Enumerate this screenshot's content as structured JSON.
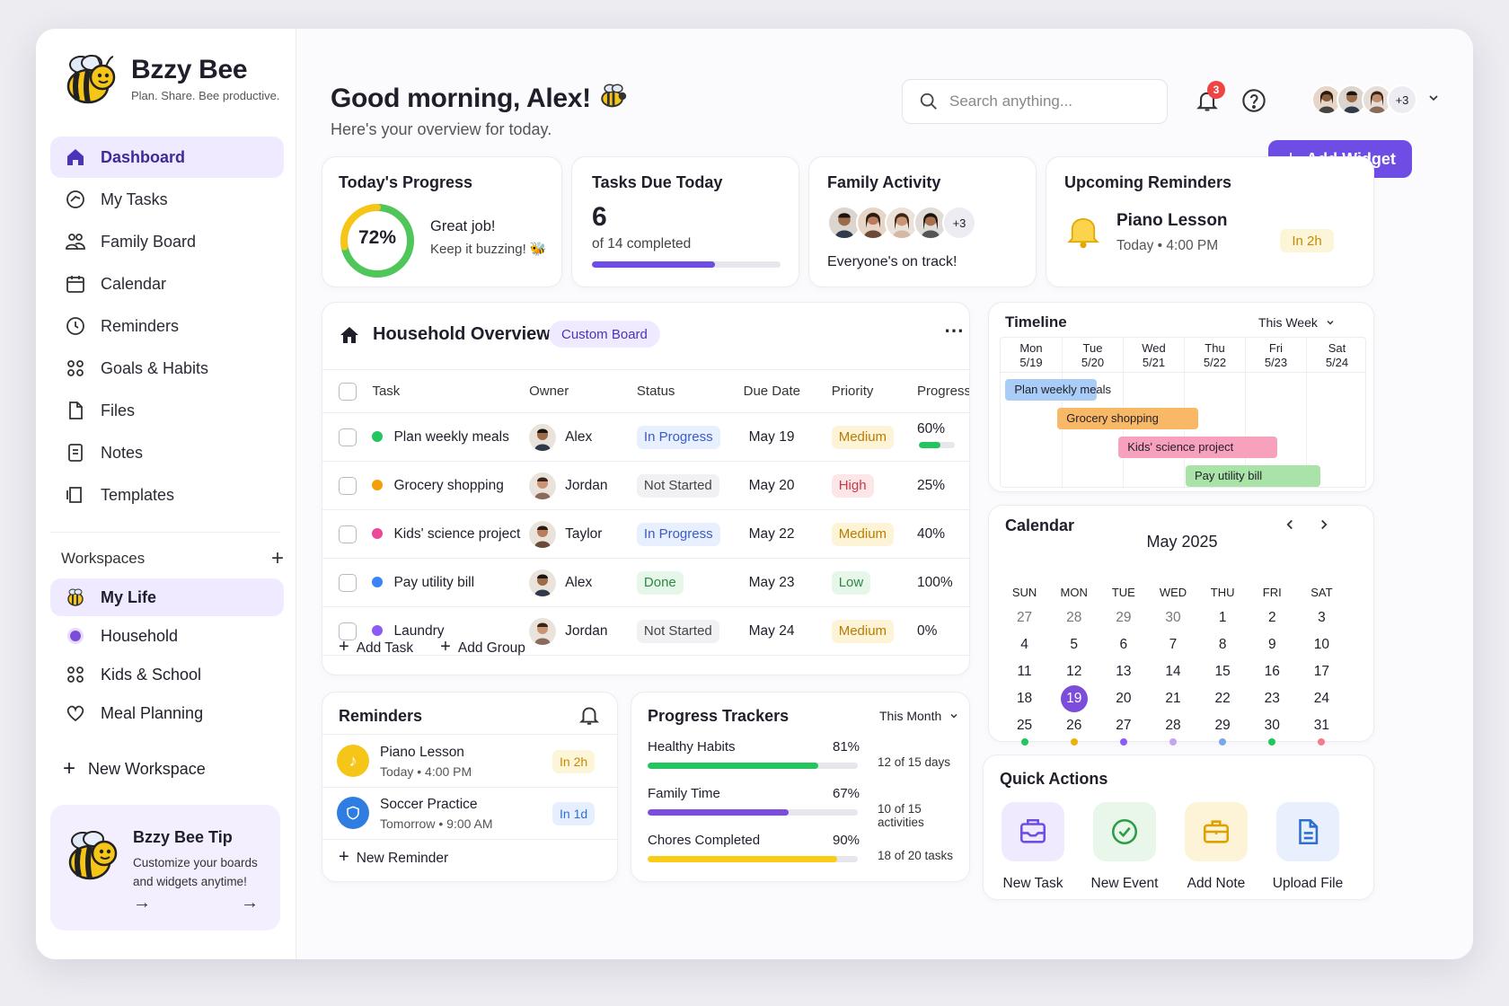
{
  "brand": {
    "name": "Bzzy Bee",
    "tagline": "Plan. Share. Bee productive."
  },
  "nav": [
    {
      "label": "Dashboard",
      "icon": "home-icon",
      "active": true
    },
    {
      "label": "My Tasks",
      "icon": "tasks-icon"
    },
    {
      "label": "Family Board",
      "icon": "family-icon"
    },
    {
      "label": "Calendar",
      "icon": "calendar-icon"
    },
    {
      "label": "Reminders",
      "icon": "clock-icon"
    },
    {
      "label": "Goals & Habits",
      "icon": "goals-icon"
    },
    {
      "label": "Files",
      "icon": "file-icon"
    },
    {
      "label": "Notes",
      "icon": "note-icon"
    },
    {
      "label": "Templates",
      "icon": "template-icon"
    }
  ],
  "workspaces": {
    "title": "Workspaces",
    "items": [
      {
        "label": "My Life",
        "icon": "bee-icon",
        "active": true
      },
      {
        "label": "Household",
        "icon": "dot-icon"
      },
      {
        "label": "Kids & School",
        "icon": "family-icon"
      },
      {
        "label": "Meal Planning",
        "icon": "meal-icon"
      }
    ],
    "new_label": "New Workspace"
  },
  "tip": {
    "title": "Bzzy Bee Tip",
    "text": "Customize your boards and widgets anytime!",
    "arrow": "→"
  },
  "header": {
    "greeting": "Good morning, Alex!",
    "subtitle": "Here's your overview for today.",
    "search_placeholder": "Search anything...",
    "notifications": "3",
    "more_members": "+3",
    "add_widget": "Add Widget"
  },
  "progress_card": {
    "title": "Today's Progress",
    "percent_label": "72%",
    "percent": 72,
    "line1": "Great job!",
    "line2": "Keep it buzzing!"
  },
  "tasks_card": {
    "title": "Tasks Due Today",
    "count": "6",
    "sub": "of 14 completed",
    "fraction": 0.65
  },
  "family_card": {
    "title": "Family Activity",
    "more": "+3",
    "status": "Everyone's on track!"
  },
  "reminders_card": {
    "title": "Upcoming Reminders",
    "item": "Piano Lesson",
    "when": "Today",
    "time": "4:00 PM",
    "badge": "In 2h"
  },
  "household": {
    "title": "Household Overview",
    "tag": "Custom Board",
    "columns": [
      "Task",
      "Owner",
      "Status",
      "Due Date",
      "Priority",
      "Progress"
    ],
    "rows": [
      {
        "task": "Plan weekly meals",
        "color": "#22c55e",
        "owner": "Alex",
        "status": "In Progress",
        "due": "May 19",
        "priority": "Medium",
        "progress": "60%",
        "pct": 60
      },
      {
        "task": "Grocery shopping",
        "color": "#f59e0b",
        "owner": "Jordan",
        "status": "Not Started",
        "due": "May 20",
        "priority": "High",
        "progress": "25%",
        "pct": 25
      },
      {
        "task": "Kids' science project",
        "color": "#ec4899",
        "owner": "Taylor",
        "status": "In Progress",
        "due": "May 22",
        "priority": "Medium",
        "progress": "40%",
        "pct": 40
      },
      {
        "task": "Pay utility bill",
        "color": "#3b82f6",
        "owner": "Alex",
        "status": "Done",
        "due": "May 23",
        "priority": "Low",
        "progress": "100%",
        "pct": 100
      },
      {
        "task": "Laundry",
        "color": "#8b5cf6",
        "owner": "Jordan",
        "status": "Not Started",
        "due": "May 24",
        "priority": "Medium",
        "progress": "0%",
        "pct": 0
      }
    ],
    "add_task": "Add Task",
    "add_group": "Add Group"
  },
  "timeline": {
    "title": "Timeline",
    "range": "This Week",
    "days": [
      {
        "d": "Mon",
        "n": "5/19"
      },
      {
        "d": "Tue",
        "n": "5/20"
      },
      {
        "d": "Wed",
        "n": "5/21"
      },
      {
        "d": "Thu",
        "n": "5/22"
      },
      {
        "d": "Fri",
        "n": "5/23"
      },
      {
        "d": "Sat",
        "n": "5/24"
      }
    ],
    "bars": [
      "Plan weekly meals",
      "Grocery shopping",
      "Kids' science project",
      "Pay utility bill"
    ]
  },
  "calendar": {
    "title": "Calendar",
    "month": "May 2025",
    "dow": [
      "SUN",
      "MON",
      "TUE",
      "WED",
      "THU",
      "FRI",
      "SAT"
    ],
    "days": [
      "27",
      "28",
      "29",
      "30",
      "1",
      "2",
      "3",
      "4",
      "5",
      "6",
      "7",
      "8",
      "9",
      "10",
      "11",
      "12",
      "13",
      "14",
      "15",
      "16",
      "17",
      "18",
      "19",
      "20",
      "21",
      "22",
      "23",
      "24",
      "25",
      "26",
      "27",
      "28",
      "29",
      "30",
      "31"
    ],
    "today": "19"
  },
  "reminders": {
    "title": "Reminders",
    "items": [
      {
        "title": "Piano Lesson",
        "when": "Today",
        "time": "4:00 PM",
        "badge": "In 2h"
      },
      {
        "title": "Soccer Practice",
        "when": "Tomorrow",
        "time": "9:00 AM",
        "badge": "In 1d"
      }
    ],
    "new_label": "New Reminder"
  },
  "trackers": {
    "title": "Progress Trackers",
    "range": "This Month",
    "items": [
      {
        "label": "Healthy Habits",
        "pct_label": "81%",
        "pct": 81,
        "detail": "12 of 15 days",
        "color": "#22c55e"
      },
      {
        "label": "Family Time",
        "pct_label": "67%",
        "pct": 67,
        "detail": "10 of 15 activities",
        "color": "#7c4ddb"
      },
      {
        "label": "Chores Completed",
        "pct_label": "90%",
        "pct": 90,
        "detail": "18 of 20 tasks",
        "color": "#facc15"
      }
    ]
  },
  "quick_actions": {
    "title": "Quick Actions",
    "items": [
      {
        "label": "New Task",
        "icon": "inbox-icon"
      },
      {
        "label": "New Event",
        "icon": "check-circle-icon"
      },
      {
        "label": "Add Note",
        "icon": "briefcase-icon"
      },
      {
        "label": "Upload File",
        "icon": "document-icon"
      }
    ]
  }
}
